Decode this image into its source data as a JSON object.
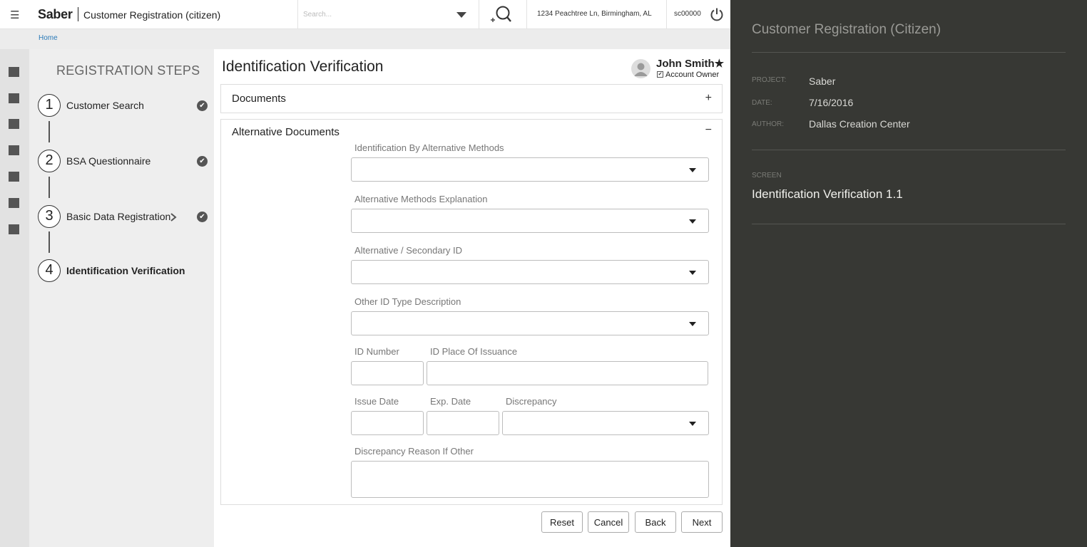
{
  "header": {
    "brand": "Saber",
    "app_title": "Customer Registration (citizen)",
    "search_placeholder": "Search...",
    "address": "1234 Peachtree Ln, Birmingham, AL",
    "user_id": "sc00000"
  },
  "breadcrumb": {
    "home": "Home"
  },
  "steps": {
    "title": "REGISTRATION STEPS",
    "items": [
      {
        "number": "1",
        "label": "Customer Search",
        "status": "complete"
      },
      {
        "number": "2",
        "label": "BSA Questionnaire",
        "status": "complete"
      },
      {
        "number": "3",
        "label": "Basic Data Registration",
        "status": "complete"
      },
      {
        "number": "4",
        "label": "Identification Verification",
        "status": "current"
      }
    ]
  },
  "main": {
    "title": "Identification Verification",
    "owner": {
      "name": "John Smith★",
      "role": "Account Owner",
      "role_checked": true
    },
    "documents_panel": {
      "title": "Documents",
      "toggle": "+"
    },
    "alt_panel": {
      "title": "Alternative Documents",
      "toggle": "−",
      "fields": {
        "id_alt_methods": {
          "label": "Identification By Alternative Methods",
          "value": ""
        },
        "alt_methods_explanation": {
          "label": "Alternative Methods Explanation",
          "value": ""
        },
        "secondary_id": {
          "label": "Alternative / Secondary ID",
          "value": ""
        },
        "other_id_type": {
          "label": "Other ID Type Description",
          "value": ""
        },
        "id_number": {
          "label": "ID Number",
          "value": ""
        },
        "id_place": {
          "label": "ID Place Of Issuance",
          "value": ""
        },
        "issue_date": {
          "label": "Issue Date",
          "value": ""
        },
        "exp_date": {
          "label": "Exp. Date",
          "value": ""
        },
        "discrepancy": {
          "label": "Discrepancy",
          "value": ""
        },
        "discrepancy_reason": {
          "label": "Discrepancy Reason If Other",
          "value": ""
        }
      }
    },
    "buttons": {
      "reset": "Reset",
      "cancel": "Cancel",
      "back": "Back",
      "next": "Next"
    }
  },
  "notes": {
    "title": "Customer Registration (Citizen)",
    "project_key": "PROJECT:",
    "project_val": "Saber",
    "date_key": "DATE:",
    "date_val": "7/16/2016",
    "author_key": "AUTHOR:",
    "author_val": "Dallas Creation Center",
    "screen_key": "SCREEN",
    "screen_val": "Identification Verification 1.1"
  },
  "colors": {
    "link": "#2a7ab8",
    "notes_bg": "#373834",
    "rail_bg": "#e2e2e2",
    "steps_bg": "#eeeeee"
  }
}
